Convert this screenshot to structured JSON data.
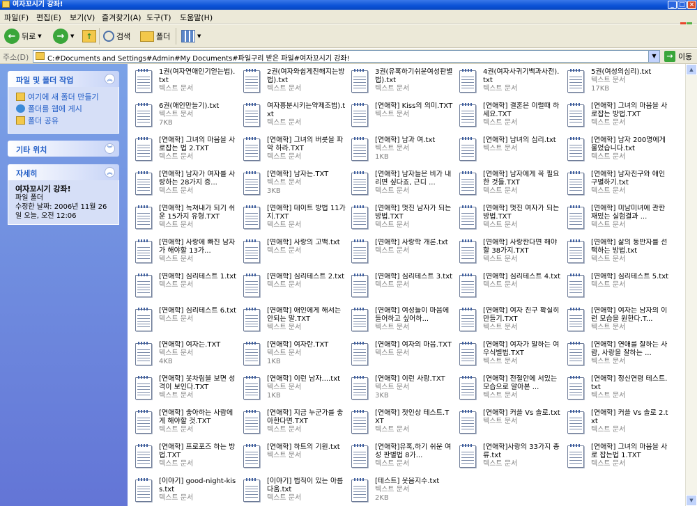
{
  "window": {
    "title": "여자꼬시기 강좌!"
  },
  "menu": [
    "파일(F)",
    "편집(E)",
    "보기(V)",
    "즐겨찾기(A)",
    "도구(T)",
    "도움말(H)"
  ],
  "toolbar": {
    "back": "뒤로",
    "search": "검색",
    "folders": "폴더"
  },
  "address": {
    "label": "주소(D)",
    "path": "C:#Documents and Settings#Admin#My Documents#파일구리 받은 파일#여자꼬시기 강좌!",
    "go": "이동"
  },
  "taskpane": {
    "file_tasks": {
      "title": "파일 및 폴더 작업",
      "links": [
        "여기에 새 폴더 만들기",
        "폴더를 웹에 게시",
        "폴더 공유"
      ]
    },
    "other_places": {
      "title": "기타 위치"
    },
    "details": {
      "title": "자세히",
      "name": "여자꼬시기 강좌!",
      "type": "파일 폴더",
      "modified": "수정한 날짜: 2006년 11월 26일 오늘, 오전 12:06"
    }
  },
  "files": [
    {
      "name": "1권(여자연애인기얻는법).txt",
      "type": "텍스트 문서",
      "size": ""
    },
    {
      "name": "2권(여자와쉽게친해지는방법).txt",
      "type": "텍스트 문서",
      "size": ""
    },
    {
      "name": "3권(유혹하기쉬운여성판별법).txt",
      "type": "텍스트 문서",
      "size": ""
    },
    {
      "name": "4권(여자사귀기백과사전).txt",
      "type": "텍스트 문서",
      "size": ""
    },
    {
      "name": "5권(여성의심리).txt",
      "type": "텍스트 문서",
      "size": "17KB"
    },
    {
      "name": "6권(애인만들기).txt",
      "type": "텍스트 문서",
      "size": "7KB"
    },
    {
      "name": "여자흥분시키는약제조법).txt",
      "type": "텍스트 문서",
      "size": ""
    },
    {
      "name": "[연애학] Kiss의 의미.TXT",
      "type": "텍스트 문서",
      "size": ""
    },
    {
      "name": "[연애학] 결혼은 이럴때 하세요.TXT",
      "type": "텍스트 문서",
      "size": ""
    },
    {
      "name": "[연애학] 그녀의 마음을 사로잡는 방법.TXT",
      "type": "텍스트 문서",
      "size": ""
    },
    {
      "name": "[연애학] 그녀의 마음을 사로잡는 법 2.TXT",
      "type": "텍스트 문서",
      "size": ""
    },
    {
      "name": "[연애학] 그녀의 버릇을 파악 하라.TXT",
      "type": "텍스트 문서",
      "size": ""
    },
    {
      "name": "[연애학] 남과 여.txt",
      "type": "텍스트 문서",
      "size": "1KB"
    },
    {
      "name": "[연애학] 남녀의 심리.txt",
      "type": "텍스트 문서",
      "size": ""
    },
    {
      "name": "[연애학] 남자 200명에게 물었습니다.txt",
      "type": "텍스트 문서",
      "size": ""
    },
    {
      "name": "[연애학] 남자가 여자를 사랑하는 28가지 증...",
      "type": "텍스트 문서",
      "size": ""
    },
    {
      "name": "[연애학] 남자는.TXT",
      "type": "텍스트 문서",
      "size": "3KB"
    },
    {
      "name": "[연애학] 남자들은 비가 내리면 싶다죠, 근디 ...",
      "type": "텍스트 문서",
      "size": ""
    },
    {
      "name": "[연애학] 남자에게 꼭 필요한 것들.TXT",
      "type": "텍스트 문서",
      "size": ""
    },
    {
      "name": "[연애학] 남자친구와 애인 구별하기.txt",
      "type": "텍스트 문서",
      "size": ""
    },
    {
      "name": "[연애학] 늑쳐내가 되기 쉬운 15가지 유형.TXT",
      "type": "텍스트 문서",
      "size": ""
    },
    {
      "name": "[연애학] 데이트 방법 11가지.TXT",
      "type": "텍스트 문서",
      "size": ""
    },
    {
      "name": "[연애학] 멋진 남자가 되는 방법.TXT",
      "type": "텍스트 문서",
      "size": ""
    },
    {
      "name": "[연애학] 멋진 여자가 되는 방법.TXT",
      "type": "텍스트 문서",
      "size": ""
    },
    {
      "name": "[연애학] 미남미녀에 관한 재밌는 실험결과 ...",
      "type": "텍스트 문서",
      "size": ""
    },
    {
      "name": "[연애학] 사랑에 빠진 남자가 해야할 13가...",
      "type": "텍스트 문서",
      "size": ""
    },
    {
      "name": "[연애학] 사랑의 고백.txt",
      "type": "텍스트 문서",
      "size": ""
    },
    {
      "name": "[연애학] 사랑학 개론.txt",
      "type": "텍스트 문서",
      "size": ""
    },
    {
      "name": "[연애학] 사랑한다면 해야할 38가지.TXT",
      "type": "텍스트 문서",
      "size": ""
    },
    {
      "name": "[연애학] 삶의 동반자를 선택하는 방법.txt",
      "type": "텍스트 문서",
      "size": ""
    },
    {
      "name": "[연애학] 심리테스트 1.txt",
      "type": "텍스트 문서",
      "size": ""
    },
    {
      "name": "[연애학] 심리테스트 2.txt",
      "type": "텍스트 문서",
      "size": ""
    },
    {
      "name": "[연애학] 심리테스트 3.txt",
      "type": "텍스트 문서",
      "size": ""
    },
    {
      "name": "[연애학] 심리테스트 4.txt",
      "type": "텍스트 문서",
      "size": ""
    },
    {
      "name": "[연애학] 심리테스트 5.txt",
      "type": "텍스트 문서",
      "size": ""
    },
    {
      "name": "[연애학] 심리테스트 6.txt",
      "type": "텍스트 문서",
      "size": ""
    },
    {
      "name": "[연애학] 애인에게 해서는 안되는 말.TXT",
      "type": "텍스트 문서",
      "size": ""
    },
    {
      "name": "[연애학] 여성들이 마음에 들어하고 싶어하...",
      "type": "텍스트 문서",
      "size": ""
    },
    {
      "name": "[연애학] 여자 친구 확실히 만들기.TXT",
      "type": "텍스트 문서",
      "size": ""
    },
    {
      "name": "[연애학] 여자는 남자의 이런 모습을 원한다.T...",
      "type": "텍스트 문서",
      "size": ""
    },
    {
      "name": "[연애학] 여자는.TXT",
      "type": "텍스트 문서",
      "size": "4KB"
    },
    {
      "name": "[연애학] 여자란.TXT",
      "type": "텍스트 문서",
      "size": "1KB"
    },
    {
      "name": "[연애학] 여자의 마음.TXT",
      "type": "텍스트 문서",
      "size": ""
    },
    {
      "name": "[연애학] 여자가 말하는 여우식별법.TXT",
      "type": "텍스트 문서",
      "size": ""
    },
    {
      "name": "[연애학] 연애를 잘하는 사람, 사랑을 잘하는 ...",
      "type": "텍스트 문서",
      "size": ""
    },
    {
      "name": "[연애학] 옷차림을 보면 성격이 보인다.TXT",
      "type": "텍스트 문서",
      "size": ""
    },
    {
      "name": "[연애학] 이런 남자....txt",
      "type": "텍스트 문서",
      "size": "1KB"
    },
    {
      "name": "[연애학] 이런 사랑.TXT",
      "type": "텍스트 문서",
      "size": "3KB"
    },
    {
      "name": "[연애학] 전철안에 서있는 모습으로 알아본 ...",
      "type": "텍스트 문서",
      "size": ""
    },
    {
      "name": "[연애학] 정신연령 테스트.txt",
      "type": "텍스트 문서",
      "size": ""
    },
    {
      "name": "[연애학] 좋아하는 사람에게 해야할 것.TXT",
      "type": "텍스트 문서",
      "size": ""
    },
    {
      "name": "[연애학] 지금 누군가를 좋아한다면.TXT",
      "type": "텍스트 문서",
      "size": ""
    },
    {
      "name": "[연애학] 첫인상 테스트.TXT",
      "type": "텍스트 문서",
      "size": ""
    },
    {
      "name": "[연애학] 커플 Vs 솔로.txt",
      "type": "텍스트 문서",
      "size": ""
    },
    {
      "name": "[연애학] 커플 Vs 솔로 2.txt",
      "type": "텍스트 문서",
      "size": ""
    },
    {
      "name": "[연애학] 프로포즈 하는 방법.TXT",
      "type": "텍스트 문서",
      "size": ""
    },
    {
      "name": "[연애학] 하트의 기원.txt",
      "type": "텍스트 문서",
      "size": ""
    },
    {
      "name": "[연애학]유혹,하기 쉬운 여성 판별법 8가...",
      "type": "텍스트 문서",
      "size": ""
    },
    {
      "name": "[연애학]사랑의 33가지 종류.txt",
      "type": "텍스트 문서",
      "size": ""
    },
    {
      "name": "[연애학] 그녀의 마음을 사로 잡는법 1.TXT",
      "type": "텍스트 문서",
      "size": ""
    },
    {
      "name": "[이야기] good-night-kiss.txt",
      "type": "텍스트 문서",
      "size": ""
    },
    {
      "name": "[이야기] 법칙이 있는 아름다움.txt",
      "type": "텍스트 문서",
      "size": ""
    },
    {
      "name": "[테스트] 웃음지수.txt",
      "type": "텍스트 문서",
      "size": "2KB"
    }
  ]
}
